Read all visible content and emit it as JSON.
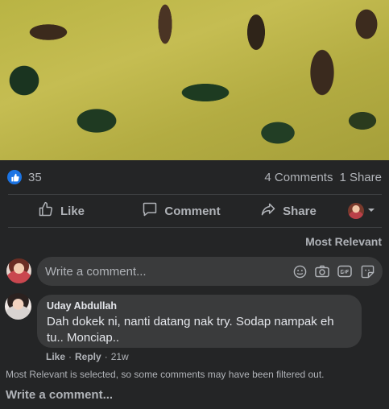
{
  "post": {
    "photo_alt": ""
  },
  "reactions": {
    "count": "35",
    "comments": "4 Comments",
    "shares": "1 Share"
  },
  "actions": {
    "like": "Like",
    "comment": "Comment",
    "share": "Share"
  },
  "comments_section": {
    "sort_label": "Most Relevant",
    "composer_placeholder": "Write a comment...",
    "comments": [
      {
        "author": "Uday Abdullah",
        "text": "Dah dokek ni, nanti datang nak try. Sodap nampak eh tu.. Monciap..",
        "like": "Like",
        "reply": "Reply",
        "time": "21w"
      }
    ],
    "filter_note": "Most Relevant is selected, so some comments may have been filtered out.",
    "write_comment": "Write a comment..."
  },
  "colors": {
    "background": "#242526",
    "bubble": "#3a3b3c",
    "like_blue": "#1b74e4",
    "text_secondary": "#b0b3b8"
  },
  "icons": [
    "like-badge-icon",
    "thumbs-up-icon",
    "comment-icon",
    "share-icon",
    "chevron-down-icon",
    "emoji-icon",
    "camera-icon",
    "gif-icon",
    "sticker-icon"
  ]
}
